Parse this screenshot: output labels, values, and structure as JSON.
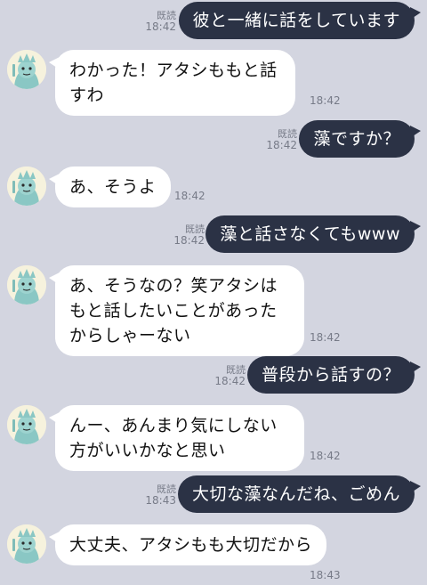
{
  "messages": [
    {
      "dir": "out",
      "text": "彼と一緒に話をしています",
      "read": "既読",
      "time": "18:42"
    },
    {
      "dir": "in",
      "text": "わかった！アタシももと話すわ",
      "time": "18:42"
    },
    {
      "dir": "out",
      "text": "藻ですか？",
      "read": "既読",
      "time": "18:42"
    },
    {
      "dir": "in",
      "text": "あ、そうよ",
      "time": "18:42"
    },
    {
      "dir": "out",
      "text": "藻と話さなくてもwww",
      "read": "既読",
      "time": "18:42"
    },
    {
      "dir": "in",
      "text": "あ、そうなの？笑アタシはもと話したいことがあったからしゃーない",
      "time": "18:42"
    },
    {
      "dir": "out",
      "text": "普段から話すの？",
      "read": "既読",
      "time": "18:42"
    },
    {
      "dir": "in",
      "text": "んー、あんまり気にしない方がいいかなと思い",
      "time": "18:42"
    },
    {
      "dir": "out",
      "text": "大切な藻なんだね、ごめん",
      "read": "既読",
      "time": "18:43"
    },
    {
      "dir": "in",
      "text": "大丈夫、アタシもも大切だから",
      "time": "18:43"
    }
  ],
  "avatar_icon": "statue-of-liberty-avatar-icon",
  "colors": {
    "background": "#d3d5e0",
    "outgoing_bubble": "#2b3245",
    "incoming_bubble": "#ffffff",
    "meta_text": "#777b88"
  }
}
